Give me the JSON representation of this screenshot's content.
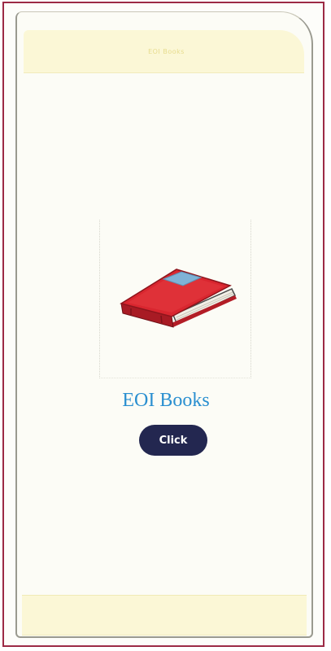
{
  "app": {
    "top_bar_title": "EOI Books",
    "book_title": "EOI Books",
    "button_label": "Click"
  },
  "images": {
    "book_icon": "book-icon"
  },
  "colors": {
    "frame_border": "#9c2a45",
    "bar_background": "#fbf7d6",
    "title_text": "#2a8fd0",
    "button_background": "#232750",
    "button_text": "#ffffff",
    "book_cover": "#d9262f"
  }
}
